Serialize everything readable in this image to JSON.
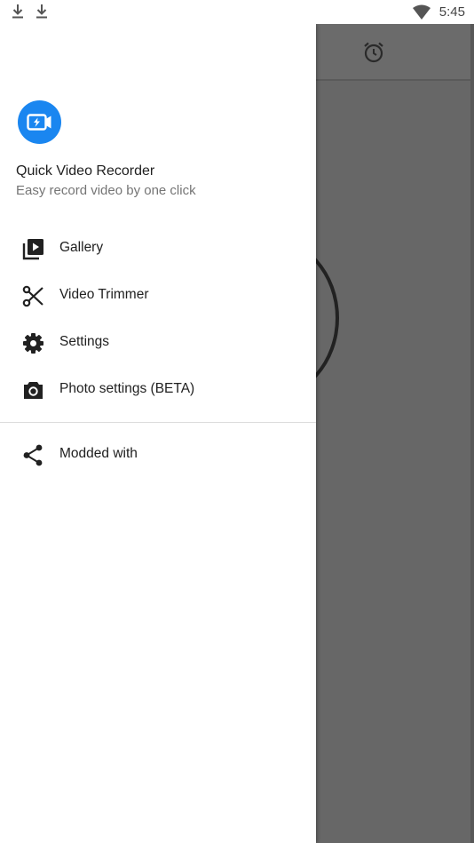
{
  "status_bar": {
    "time": "5:45",
    "icons": [
      "download-icon",
      "download-icon",
      "wifi-icon"
    ]
  },
  "drawer": {
    "app_name": "Quick Video Recorder",
    "tagline": "Easy record video by one click",
    "logo_icon": "video-camera-flash-icon",
    "logo_color": "#1a86f0",
    "menu": [
      {
        "label": "Gallery",
        "icon": "gallery-icon"
      },
      {
        "label": "Video Trimmer",
        "icon": "scissors-icon"
      },
      {
        "label": "Settings",
        "icon": "gear-icon"
      },
      {
        "label": "Photo settings (BETA)",
        "icon": "camera-icon"
      }
    ],
    "secondary_menu": [
      {
        "label": "Modded with",
        "icon": "share-icon"
      }
    ]
  },
  "background_app": {
    "toolbar_icon": "alarm-icon"
  }
}
